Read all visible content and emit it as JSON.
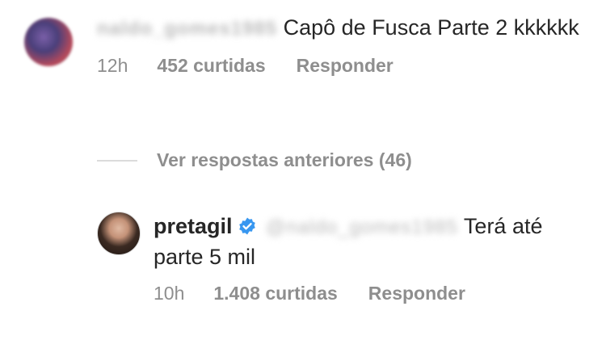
{
  "comment1": {
    "username": "naldo_gomes1985",
    "text": "Capô de Fusca Parte 2 kkkkkk",
    "time": "12h",
    "likes": "452 curtidas",
    "reply_label": "Responder"
  },
  "view_replies": "Ver respostas anteriores (46)",
  "comment2": {
    "username": "pretagil",
    "mention": "@naldo_gomes1985",
    "text": "Terá até parte 5 mil",
    "time": "10h",
    "likes": "1.408 curtidas",
    "reply_label": "Responder"
  },
  "colors": {
    "text": "#262626",
    "muted": "#8e8e8e",
    "verified": "#3897f0",
    "divider": "#dbdbdb"
  },
  "icons": {
    "verified": "verified-badge-icon"
  }
}
